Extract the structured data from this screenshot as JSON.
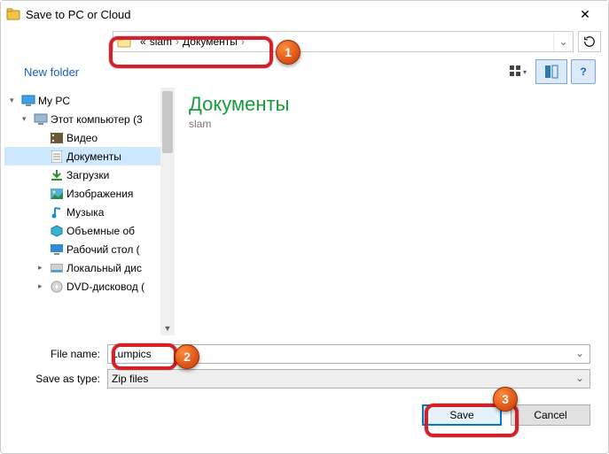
{
  "title": "Save to PC or Cloud",
  "breadcrumbs": {
    "pre": "«",
    "p1": "slam",
    "p2": "Документы"
  },
  "toolbar": {
    "new_folder": "New folder"
  },
  "tree": {
    "root": "My PC",
    "l1": "Этот компьютер (3",
    "items": [
      "Видео",
      "Документы",
      "Загрузки",
      "Изображения",
      "Музыка",
      "Объемные об",
      "Рабочий стол (",
      "Локальный дис",
      "DVD-дисковод ("
    ]
  },
  "content": {
    "title": "Документы",
    "sub": "slam"
  },
  "form": {
    "file_name_label": "File name:",
    "file_name_value": "Lumpics",
    "save_type_label": "Save as type:",
    "save_type_value": "Zip files"
  },
  "buttons": {
    "save": "Save",
    "cancel": "Cancel"
  },
  "badges": {
    "b1": "1",
    "b2": "2",
    "b3": "3"
  }
}
